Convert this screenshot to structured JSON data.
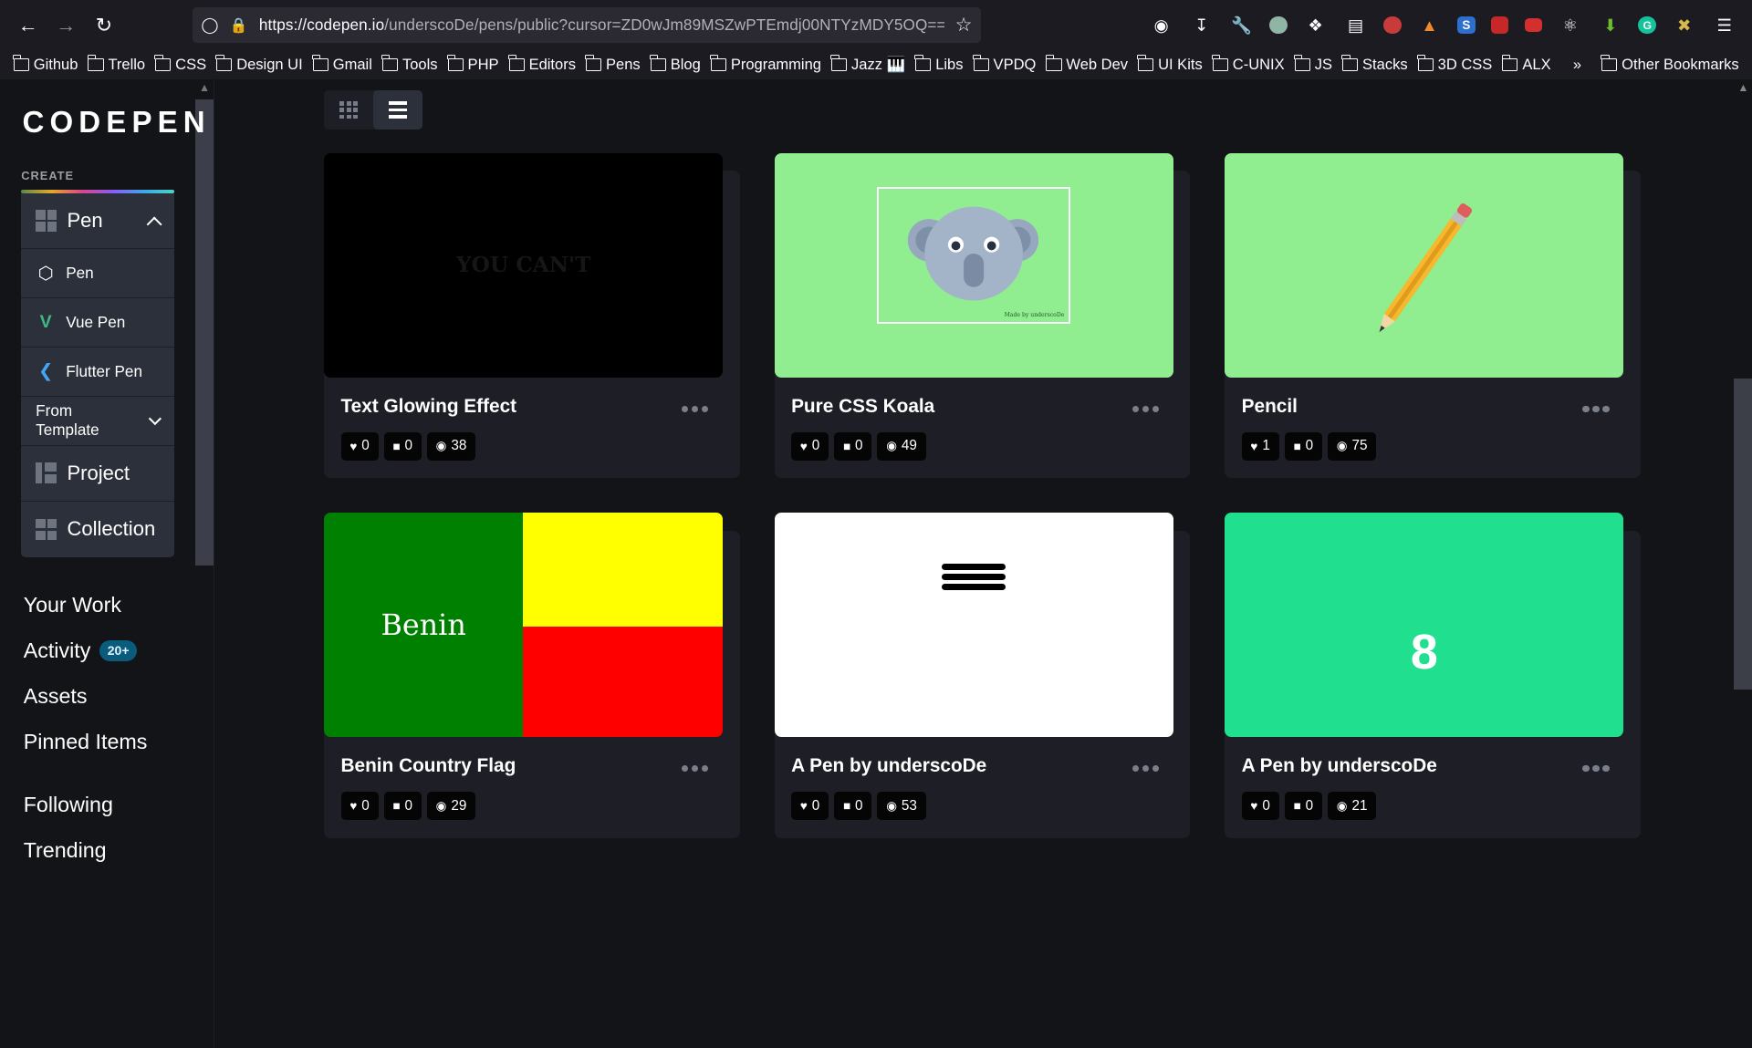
{
  "browser": {
    "url_host": "https://codepen.io",
    "url_rest": "/underscoDe/pens/public?cursor=ZD0wJm89MSZwPTEmdj00NTYzMDY5OQ==",
    "bookmarks": [
      "Github",
      "Trello",
      "CSS",
      "Design UI",
      "Gmail",
      "Tools",
      "PHP",
      "Editors",
      "Pens",
      "Blog",
      "Programming",
      "Jazz 🎹",
      "Libs",
      "VPDQ",
      "Web Dev",
      "UI Kits",
      "C-UNIX",
      "JS",
      "Stacks",
      "3D CSS",
      "ALX"
    ],
    "other_bookmarks": "Other Bookmarks",
    "overflow": "»"
  },
  "sidebar": {
    "logo": "CODEPEN",
    "create_label": "CREATE",
    "pen_main": "Pen",
    "items": [
      "Pen",
      "Vue Pen",
      "Flutter Pen",
      "From Template"
    ],
    "project": "Project",
    "collection": "Collection",
    "nav": {
      "your_work": "Your Work",
      "activity": "Activity",
      "activity_badge": "20+",
      "assets": "Assets",
      "pinned": "Pinned Items",
      "following": "Following",
      "trending": "Trending"
    }
  },
  "cards": [
    {
      "title": "Text Glowing Effect",
      "likes": "0",
      "comments": "0",
      "views": "38",
      "thumb_text": "YOU CAN'T"
    },
    {
      "title": "Pure CSS Koala",
      "likes": "0",
      "comments": "0",
      "views": "49",
      "thumb_text": "Made by underscoDe"
    },
    {
      "title": "Pencil",
      "likes": "1",
      "comments": "0",
      "views": "75"
    },
    {
      "title": "Benin Country Flag",
      "likes": "0",
      "comments": "0",
      "views": "29",
      "thumb_text": "Benin"
    },
    {
      "title": "A Pen by underscoDe",
      "likes": "0",
      "comments": "0",
      "views": "53"
    },
    {
      "title": "A Pen by underscoDe",
      "likes": "0",
      "comments": "0",
      "views": "21",
      "thumb_text": "8"
    }
  ],
  "colors": {
    "bg": "#131417",
    "card": "#1e1f26",
    "koala_green": "#90ee90",
    "teal": "#20df8f",
    "benin_green": "#008000",
    "benin_yellow": "#ffff00",
    "benin_red": "#ff0000"
  }
}
